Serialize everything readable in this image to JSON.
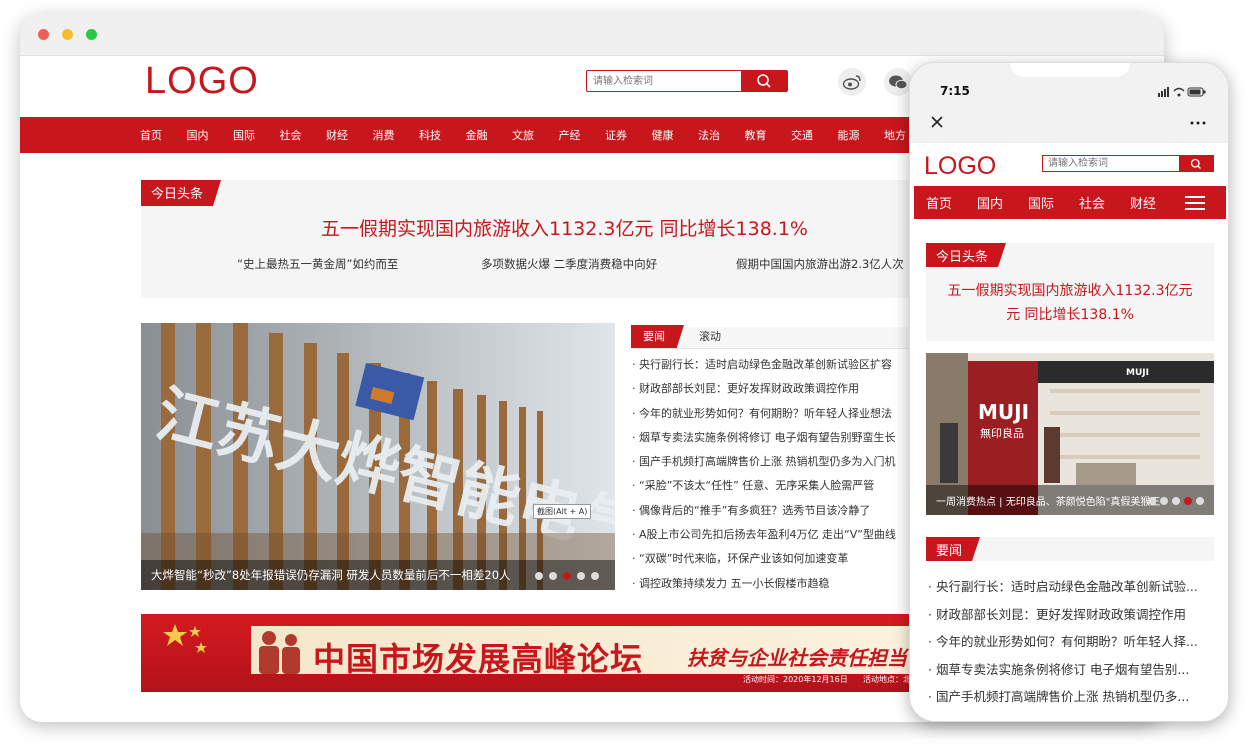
{
  "window_dots": [
    "#ee5f58",
    "#f6be2f",
    "#29c840"
  ],
  "desktop": {
    "logo": "LOGO",
    "search_placeholder": "请输入检索词",
    "nav": [
      "首页",
      "国内",
      "国际",
      "社会",
      "财经",
      "消费",
      "科技",
      "金融",
      "文旅",
      "产经",
      "证券",
      "健康",
      "法治",
      "教育",
      "交通",
      "能源",
      "地方"
    ],
    "headline": {
      "tag": "今日头条",
      "main": "五一假期实现国内旅游收入1132.3亿元 同比增长138.1%",
      "subs": [
        "“史上最热五一黄金周”如约而至",
        "多项数据火爆 二季度消费稳中向好",
        "假期中国国内旅游出游2.3亿人次"
      ]
    },
    "slider": {
      "caption": "大烨智能“秒改”8处年报错误仍存漏洞 研发人员数量前后不一相差20人",
      "dots": 5,
      "active_dot": 2,
      "tooltip": "截图(Alt + A)"
    },
    "news": {
      "tab_active": "要闻",
      "tab_other": "滚动",
      "items": [
        "· 央行副行长：适时启动绿色金融改革创新试验区扩容",
        "· 财政部部长刘昆：更好发挥财政政策调控作用",
        "· 今年的就业形势如何？有何期盼？听年轻人择业想法",
        "· 烟草专卖法实施条例将修订 电子烟有望告别野蛮生长",
        "· 国产手机频打高端牌售价上涨 热销机型仍多为入门机",
        "· “采脸”不该太“任性” 任意、无序采集人脸需严管",
        "· 偶像背后的“推手”有多疯狂？选秀节目该冷静了",
        "· A股上市公司先扣后扬去年盈利4万亿 走出“V”型曲线",
        "· “双碳”时代来临，环保产业该如何加速变革",
        "· 调控政策持续发力 五一小长假楼市趋稳"
      ]
    },
    "banner": {
      "title": "中国市场发展高峰论坛",
      "slogan": "扶贫与企业社会责任担当",
      "time": "活动时间：2020年12月16日",
      "place": "活动地点：北"
    }
  },
  "mobile": {
    "time": "7:15",
    "logo": "LOGO",
    "search_placeholder": "请输入检索词",
    "nav": [
      "首页",
      "国内",
      "国际",
      "社会",
      "财经"
    ],
    "headline_tag": "今日头条",
    "headline_line1": "五一假期实现国内旅游收入1132.3亿元",
    "headline_line2": "元 同比增长138.1%",
    "image_caption": "一周消费热点 | 无印良品、茶颜悦色陷\"真假美猴王\"",
    "image_dots": 5,
    "image_active_dot": 3,
    "section_tag": "要闻",
    "list": [
      "· 央行副行长：适时启动绿色金融改革创新试验...",
      "· 财政部部长刘昆：更好发挥财政政策调控作用",
      "· 今年的就业形势如何？有何期盼？听年轻人择...",
      "· 烟草专卖法实施条例将修订 电子烟有望告别...",
      "· 国产手机频打高端牌售价上涨 热销机型仍多..."
    ]
  }
}
